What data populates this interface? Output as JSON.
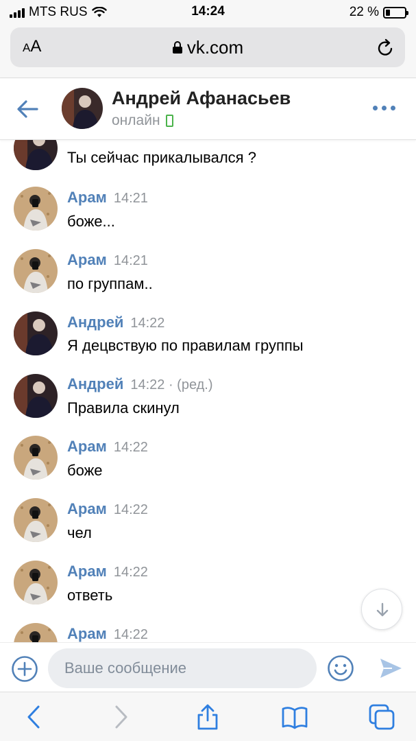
{
  "status_bar": {
    "carrier": "MTS RUS",
    "time": "14:24",
    "battery": "22 %",
    "battery_level": 0.22
  },
  "browser": {
    "aa_label": "AA",
    "url": "vk.com"
  },
  "chat_header": {
    "name": "Андрей Афанасьев",
    "status": "онлайн"
  },
  "messages": [
    {
      "author": "",
      "time": "",
      "text": "Ты сейчас прикалывался ?",
      "avatar": "andrey"
    },
    {
      "author": "Арам",
      "time": "14:21",
      "text": "боже...",
      "avatar": "aram"
    },
    {
      "author": "Арам",
      "time": "14:21",
      "text": "по группам..",
      "avatar": "aram"
    },
    {
      "author": "Андрей",
      "time": "14:22",
      "text": "Я децвствую по правилам группы",
      "avatar": "andrey"
    },
    {
      "author": "Андрей",
      "time": "14:22 · (ред.)",
      "text": "Правила скинул",
      "avatar": "andrey"
    },
    {
      "author": "Арам",
      "time": "14:22",
      "text": "боже",
      "avatar": "aram"
    },
    {
      "author": "Арам",
      "time": "14:22",
      "text": "чел",
      "avatar": "aram"
    },
    {
      "author": "Арам",
      "time": "14:22",
      "text": "ответь",
      "avatar": "aram"
    },
    {
      "author": "Арам",
      "time": "14:22",
      "text": "",
      "avatar": "aram"
    }
  ],
  "composer": {
    "placeholder": "Ваше сообщение"
  },
  "colors": {
    "accent": "#5181b8",
    "online": "#4bb34b",
    "safari_blue": "#2f7fe0"
  },
  "icons": {
    "back": "back-arrow-icon",
    "more": "more-dots-icon",
    "add": "plus-circle-icon",
    "emoji": "smile-icon",
    "send": "send-icon",
    "scroll_down": "arrow-down-icon"
  }
}
